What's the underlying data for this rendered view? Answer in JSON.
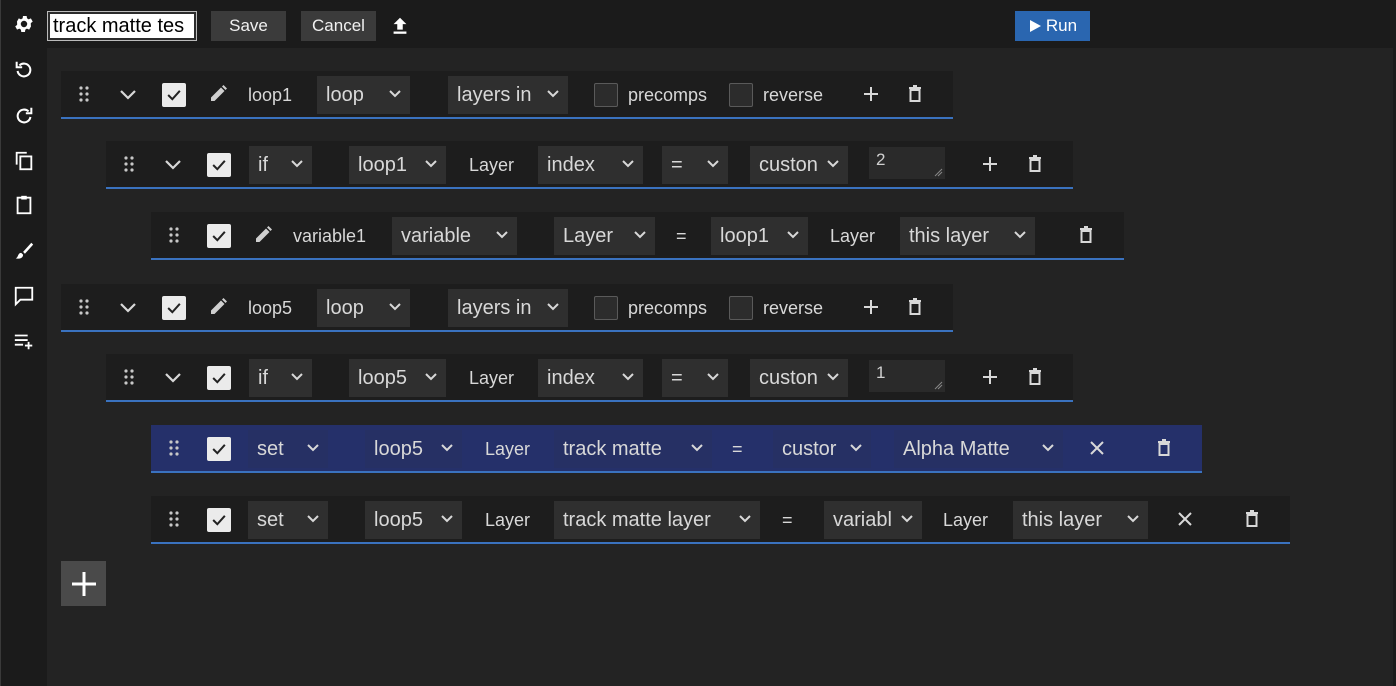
{
  "toolbar": {
    "title_value": "track matte tes",
    "save_label": "Save",
    "cancel_label": "Cancel",
    "run_label": "Run"
  },
  "sidebar": {
    "icons": [
      "gear-icon",
      "undo-icon",
      "redo-icon",
      "copy-icon",
      "paste-icon",
      "brush-icon",
      "comment-icon",
      "add-list-icon"
    ]
  },
  "rows": {
    "r1": {
      "name": "loop1",
      "type": "loop",
      "source": "layers in",
      "precomps": "precomps",
      "reverse": "reverse"
    },
    "r2": {
      "kind": "if",
      "target": "loop1",
      "label": "Layer",
      "property": "index",
      "op": "=",
      "mode": "custon",
      "value": "2"
    },
    "r3": {
      "name": "variable1",
      "type": "variable",
      "vtype": "Layer",
      "op": "=",
      "target": "loop1",
      "label": "Layer",
      "value": "this layer"
    },
    "r4": {
      "name": "loop5",
      "type": "loop",
      "source": "layers in",
      "precomps": "precomps",
      "reverse": "reverse"
    },
    "r5": {
      "kind": "if",
      "target": "loop5",
      "label": "Layer",
      "property": "index",
      "op": "=",
      "mode": "custon",
      "value": "1"
    },
    "r6": {
      "kind": "set",
      "target": "loop5",
      "label": "Layer",
      "property": "track matte",
      "op": "=",
      "mode": "custor",
      "value": "Alpha Matte"
    },
    "r7": {
      "kind": "set",
      "target": "loop5",
      "label": "Layer",
      "property": "track matte layer",
      "op": "=",
      "mode": "variabl",
      "label2": "Layer",
      "value": "this layer"
    }
  },
  "colors": {
    "accent": "#2a66b0",
    "row_border": "#3a72bf",
    "highlight_row": "#25306a"
  }
}
